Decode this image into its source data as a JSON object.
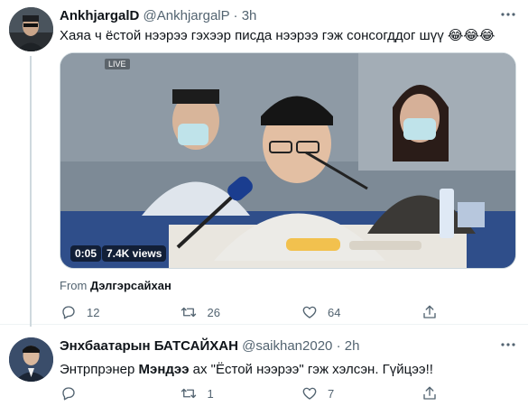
{
  "tweet1": {
    "name": "AnkhjargalD",
    "handle": "@AnkhjargalP",
    "dot": "·",
    "time": "3h",
    "text": "Хаяа ч ёстой нээрээ гэхээр писда нээрээ гэж сонсогддог шүү 😂😂😂",
    "media": {
      "badge": "LIVE",
      "duration": "0:05",
      "views": "7.4K views"
    },
    "from_label": "From",
    "from_source": "Дэлгэрсайхан",
    "actions": {
      "replies": "12",
      "retweets": "26",
      "likes": "64"
    }
  },
  "tweet2": {
    "name": "Энхбаатарын БАТСАЙХАН",
    "handle": "@saikhan2020",
    "dot": "·",
    "time": "2h",
    "text_before": "Энтрпрэнер ",
    "text_mention": "Мэндээ",
    "text_after": " ах \"Ёстой нээрээ\" гэж хэлсэн. Гүйцээ!!",
    "actions": {
      "replies": "",
      "retweets": "1",
      "likes": "7"
    }
  },
  "icons": {
    "reply": "reply-icon",
    "retweet": "retweet-icon",
    "like": "heart-icon",
    "share": "share-icon",
    "more": "more-icon"
  },
  "colors": {
    "text": "#0f1419",
    "secondary": "#536471",
    "border": "#eff3f4"
  }
}
